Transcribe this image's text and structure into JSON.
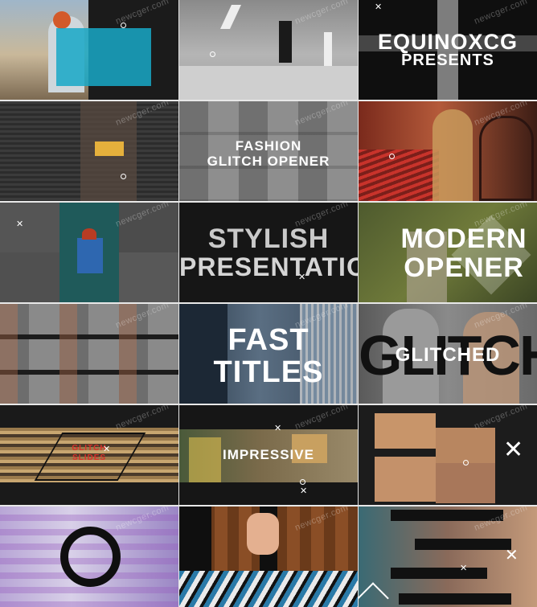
{
  "watermark": "newcger.com",
  "tiles": [
    {
      "title": ""
    },
    {
      "title": ""
    },
    {
      "title_line1": "EQUINOXCG",
      "title_line2": "PRESENTS"
    },
    {
      "title": ""
    },
    {
      "title_line1": "FASHION",
      "title_line2": "GLITCH OPENER"
    },
    {
      "title": ""
    },
    {
      "title": ""
    },
    {
      "title_line1": "STYLISH",
      "title_line2": "PRESENTATION"
    },
    {
      "title_line1": "MODERN",
      "title_line2": "OPENER"
    },
    {
      "title": ""
    },
    {
      "title_line1": "FAST",
      "title_line2": "TITLES"
    },
    {
      "title_bg": "GLITCHED",
      "title": "GLITCHED"
    },
    {
      "title_line1": "GLITCH",
      "title_line2": "SLIDES"
    },
    {
      "title": "IMPRESSIVE"
    },
    {
      "title": ""
    },
    {
      "title": ""
    },
    {
      "title": ""
    },
    {
      "title": ""
    }
  ],
  "colors": {
    "accent_cyan": "#1aa6c4",
    "accent_red": "#d8312a"
  }
}
